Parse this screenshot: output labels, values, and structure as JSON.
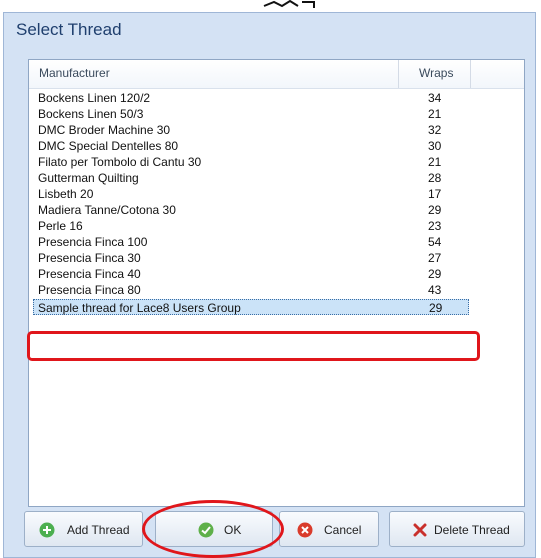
{
  "window": {
    "title": "Select Thread"
  },
  "table": {
    "columns": [
      "Manufacturer",
      "Wraps"
    ],
    "rows": [
      {
        "manufacturer": "Bockens Linen 120/2",
        "wraps": "34"
      },
      {
        "manufacturer": "Bockens Linen 50/3",
        "wraps": "21"
      },
      {
        "manufacturer": "DMC Broder Machine 30",
        "wraps": "32"
      },
      {
        "manufacturer": "DMC Special Dentelles 80",
        "wraps": "30"
      },
      {
        "manufacturer": "Filato per Tombolo di Cantu 30",
        "wraps": "21"
      },
      {
        "manufacturer": "Gutterman Quilting",
        "wraps": "28"
      },
      {
        "manufacturer": "Lisbeth 20",
        "wraps": "17"
      },
      {
        "manufacturer": "Madiera Tanne/Cotona 30",
        "wraps": "29"
      },
      {
        "manufacturer": "Perle 16",
        "wraps": "23"
      },
      {
        "manufacturer": "Presencia Finca 100",
        "wraps": "54"
      },
      {
        "manufacturer": "Presencia Finca 30",
        "wraps": "27"
      },
      {
        "manufacturer": "Presencia Finca 40",
        "wraps": "29"
      },
      {
        "manufacturer": "Presencia Finca 80",
        "wraps": "43"
      },
      {
        "manufacturer": "Sample thread for Lace8 Users Group",
        "wraps": "29",
        "selected": true
      }
    ]
  },
  "buttons": {
    "add": {
      "label": "Add Thread",
      "icon": "plus-circle-icon"
    },
    "ok": {
      "label": "OK",
      "icon": "check-circle-icon"
    },
    "cancel": {
      "label": "Cancel",
      "icon": "x-circle-icon"
    },
    "delete": {
      "label": "Delete Thread",
      "icon": "scissors-x-icon"
    }
  },
  "colors": {
    "annotation": "#e0161b",
    "dialog_bg": "#d4e2f4",
    "title_text": "#1f3f6e",
    "selection": "#cbe3f8"
  }
}
